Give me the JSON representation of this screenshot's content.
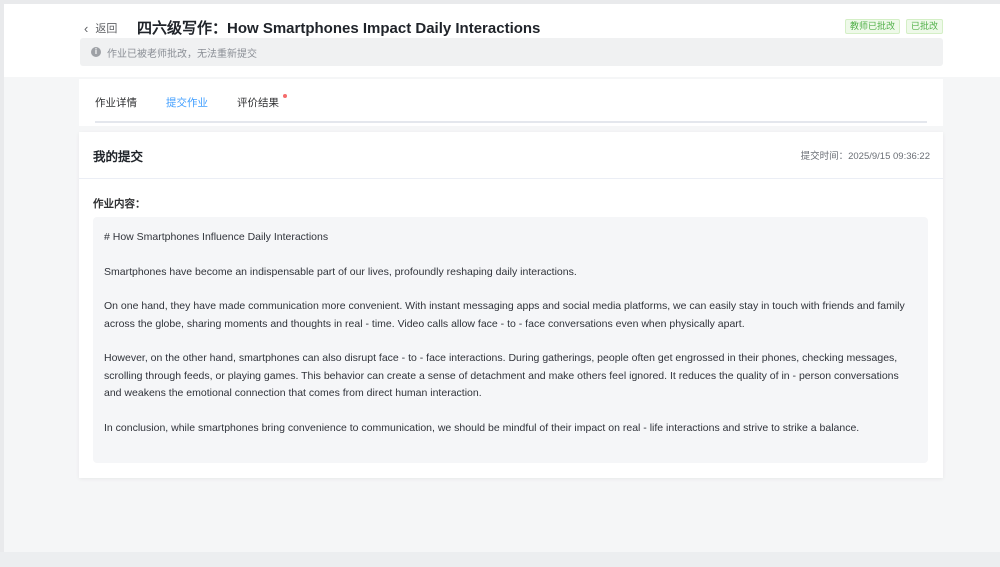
{
  "header": {
    "back_label": "返回",
    "title": "四六级写作：How Smartphones Impact Daily Interactions",
    "tags": [
      "教师已批改",
      "已批改"
    ],
    "notice": "作业已被老师批改，无法重新提交"
  },
  "tabs": [
    {
      "label": "作业详情",
      "active": false
    },
    {
      "label": "提交作业",
      "active": true
    },
    {
      "label": "评价结果",
      "active": false,
      "dot": true
    }
  ],
  "submission": {
    "title": "我的提交",
    "submit_time": "提交时间：2025/9/15 09:36:22",
    "content_label": "作业内容：",
    "paragraphs": [
      "# How Smartphones Influence Daily Interactions",
      "Smartphones have become an indispensable part of our lives, profoundly reshaping daily interactions.",
      "On one hand, they have made communication more convenient. With instant messaging apps and social media platforms, we can easily stay in touch with friends and family across the globe, sharing moments and thoughts in real - time. Video calls allow face - to - face conversations even when physically apart.",
      "However, on the other hand, smartphones can also disrupt face - to - face interactions. During gatherings, people often get engrossed in their phones, checking messages, scrolling through feeds, or playing games. This behavior can create a sense of detachment and make others feel ignored. It reduces the quality of in - person conversations and weakens the emotional connection that comes from direct human interaction.",
      "In conclusion, while smartphones bring convenience to communication, we should be mindful of their impact on real - life interactions and strive to strike a balance."
    ]
  },
  "colors": {
    "accent": "#409eff",
    "success": "#52b14a",
    "dot": "#f56c6c"
  }
}
